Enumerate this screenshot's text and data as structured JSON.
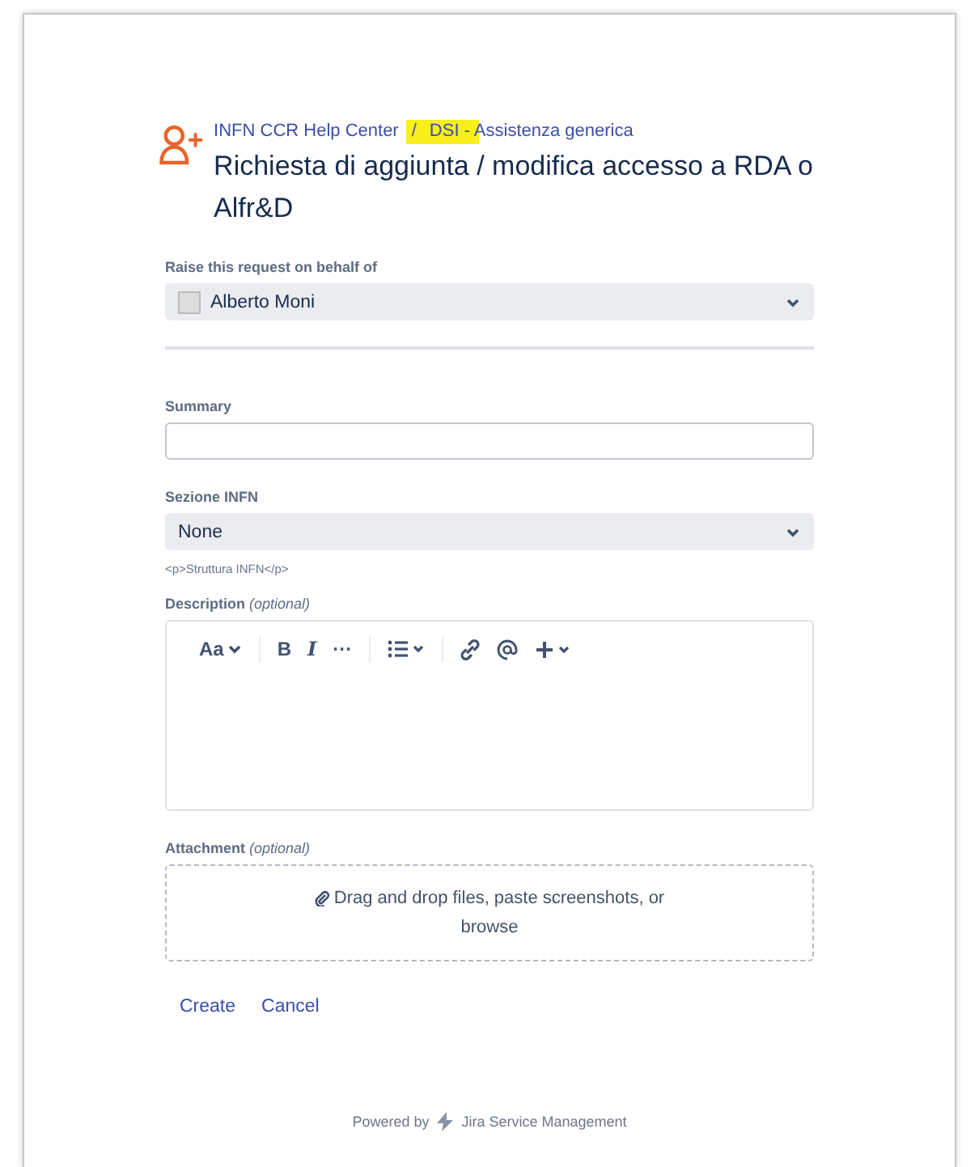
{
  "breadcrumb": [
    {
      "label": "INFN CCR Help Center"
    },
    {
      "label": "DSI - Assistenza generica",
      "highlighted": true
    }
  ],
  "separator": "/",
  "title": "Richiesta di aggiunta / modifica accesso a RDA o Alfr&D",
  "fields": [
    {
      "kind": "user-select",
      "label": "Raise this request on behalf of",
      "value": "Alberto Moni"
    },
    {
      "kind": "divider"
    },
    {
      "kind": "text",
      "label": "Summary"
    },
    {
      "kind": "select",
      "label": "Sezione INFN",
      "value": "None",
      "help": "<p>Struttura INFN</p>"
    },
    {
      "kind": "editor",
      "label": "Description",
      "optional": "(optional)",
      "toolbar": [
        "Aa",
        "B",
        "I",
        "···"
      ]
    },
    {
      "kind": "attachment",
      "label": "Attachment",
      "optional": "(optional)",
      "text": "Drag and drop files, paste screenshots, or",
      "link": "browse"
    }
  ],
  "actions": [
    "Create",
    "Cancel"
  ],
  "footer": {
    "prefix": "Powered by",
    "product": "Jira Service Management"
  }
}
